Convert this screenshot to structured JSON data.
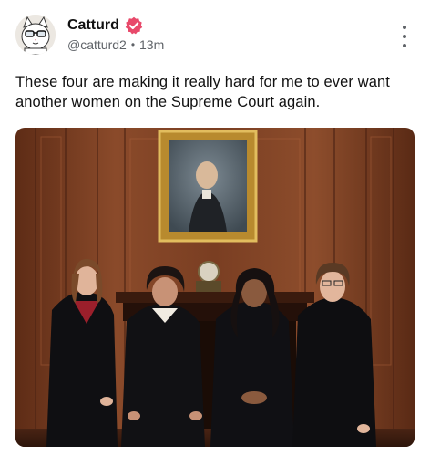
{
  "post": {
    "author": {
      "display_name": "Catturd",
      "handle": "@catturd2",
      "verified": true,
      "avatar": "cartoon-cat-avatar"
    },
    "separator": "•",
    "time_ago": "13m",
    "more_icon": "vertical-ellipsis-icon",
    "text": "These four are making it really hard for me to ever want another women on the Supreme Court again.",
    "media": {
      "type": "photo",
      "description_icon": "group-photo"
    }
  },
  "colors": {
    "verified_badge": "#e8496a",
    "muted_text": "#5f6368",
    "wood_panel": "#7a3e22"
  }
}
